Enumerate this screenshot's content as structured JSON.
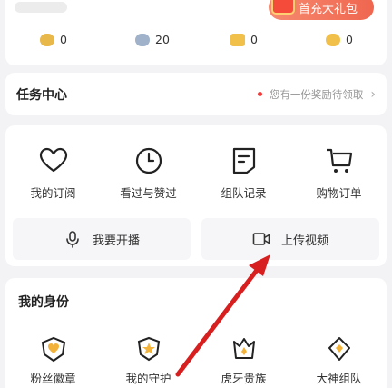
{
  "profile": {
    "recharge_label": "首充大礼包"
  },
  "assets": [
    {
      "icon": "gold-coin-icon",
      "value": "0",
      "color": "#e9b84a"
    },
    {
      "icon": "silver-coin-icon",
      "value": "20",
      "color": "#9fb2c9"
    },
    {
      "icon": "ticket-icon",
      "value": "0",
      "color": "#f1c04b"
    },
    {
      "icon": "smile-coin-icon",
      "value": "0",
      "color": "#f1c04b"
    }
  ],
  "task_center": {
    "title": "任务中心",
    "hint": "您有一份奖励待领取"
  },
  "shortcuts": [
    {
      "icon": "heart-icon",
      "label": "我的订阅"
    },
    {
      "icon": "clock-icon",
      "label": "看过与赞过"
    },
    {
      "icon": "document-icon",
      "label": "组队记录"
    },
    {
      "icon": "cart-icon",
      "label": "购物订单"
    }
  ],
  "actions": {
    "broadcast_label": "我要开播",
    "upload_label": "上传视频"
  },
  "identity": {
    "title": "我的身份",
    "items": [
      {
        "icon": "fan-badge-icon",
        "label": "粉丝徽章"
      },
      {
        "icon": "guard-icon",
        "label": "我的守护"
      },
      {
        "icon": "noble-crown-icon",
        "label": "虎牙贵族"
      },
      {
        "icon": "team-badge-icon",
        "label": "大神组队"
      }
    ]
  },
  "colors": {
    "accent_red": "#e02a2a",
    "recharge_bg": "#f0664f"
  }
}
